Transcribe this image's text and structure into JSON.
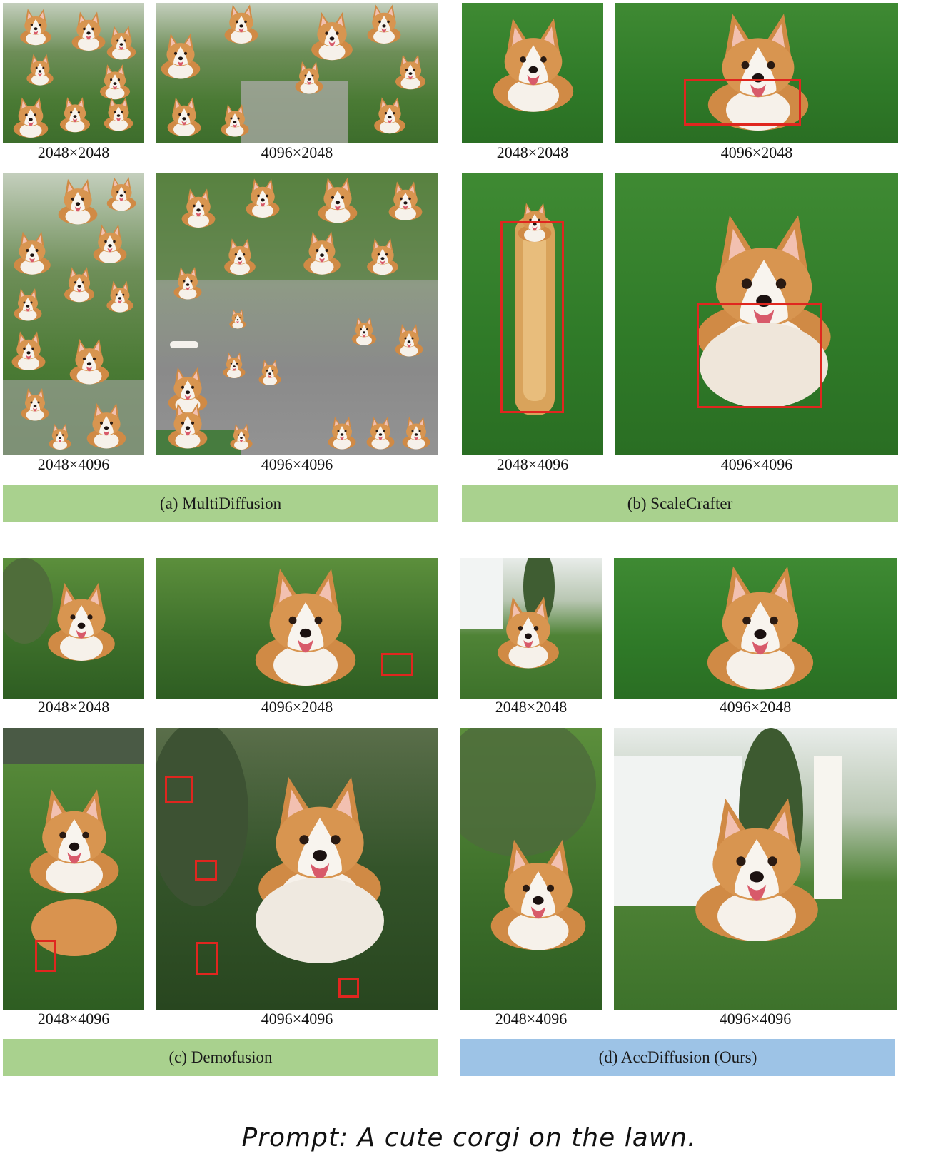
{
  "panels": [
    {
      "id": "a",
      "label": "(a) MultiDiffusion",
      "images": [
        {
          "caption": "2048×2048",
          "alt": "grid of many corgis on grass"
        },
        {
          "caption": "4096×2048",
          "alt": "repeated corgis collage"
        },
        {
          "caption": "2048×4096",
          "alt": "tall collage of corgis"
        },
        {
          "caption": "4096×4096",
          "alt": "corgis scattered on grey ground"
        }
      ]
    },
    {
      "id": "b",
      "label": "(b) ScaleCrafter",
      "images": [
        {
          "caption": "2048×2048",
          "alt": "corgi lying on lawn"
        },
        {
          "caption": "4096×2048",
          "alt": "corgi with distorted body"
        },
        {
          "caption": "2048×4096",
          "alt": "elongated corgi top view"
        },
        {
          "caption": "4096×4096",
          "alt": "large corgi with distorted chest"
        }
      ]
    },
    {
      "id": "c",
      "label": "(c) Demofusion",
      "images": [
        {
          "caption": "2048×2048",
          "alt": "corgi sitting near bushes"
        },
        {
          "caption": "4096×2048",
          "alt": "corgi lying on grass with tiny artifact"
        },
        {
          "caption": "2048×4096",
          "alt": "corgi running on lawn"
        },
        {
          "caption": "4096×4096",
          "alt": "corgi sitting with small duplicated artifacts"
        }
      ]
    },
    {
      "id": "d",
      "label": "(d) AccDiffusion (Ours)",
      "images": [
        {
          "caption": "2048×2048",
          "alt": "corgi in front of white house"
        },
        {
          "caption": "4096×2048",
          "alt": "corgi lying on lawn"
        },
        {
          "caption": "2048×4096",
          "alt": "corgi sitting on grass"
        },
        {
          "caption": "4096×4096",
          "alt": "corgi sitting in front of house"
        }
      ]
    }
  ],
  "prompt": "Prompt: A cute corgi on the lawn.",
  "colors": {
    "banner_green": "#a9d18e",
    "banner_blue": "#9dc3e6",
    "highlight_box": "#e0261f"
  }
}
